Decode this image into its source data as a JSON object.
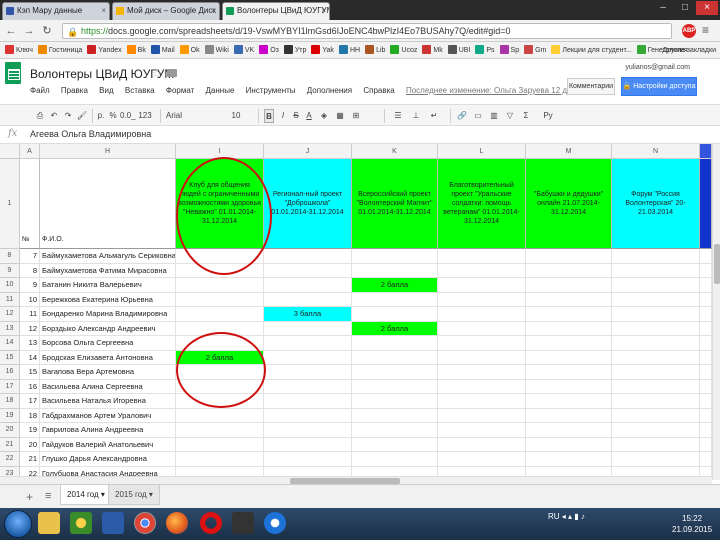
{
  "browser": {
    "tabs": [
      {
        "title": "Кэп Мару данные",
        "active": false
      },
      {
        "title": "Мой диск – Google Диск",
        "active": false
      },
      {
        "title": "Волонтеры ЦВиД ЮУГУМ",
        "active": true
      }
    ],
    "url_protocol": "https://",
    "url_rest": "docs.google.com/spreadsheets/d/19-VswMYBYI1lmGsd6IJoENC4bwPlzI4Eo7BUSAhy7Q/edit#gid=0",
    "adblock_label": "ABP",
    "bookmarks": [
      "Ключ",
      "Гостиница",
      "Yandex",
      "Bk",
      "Mail",
      "Ok",
      "Wiki",
      "VK",
      "Оз",
      "Утр",
      "Yak",
      "НН",
      "Lib",
      "Ucoz",
      "Mk",
      "UBI",
      "Ps",
      "Sp",
      "Gm",
      "Лекции для студент...",
      "Генетология"
    ],
    "other_bookmarks": "Другие закладки"
  },
  "docs": {
    "title": "Волонтеры ЦВиД ЮУГУМ",
    "user_email": "yulianos@gmail.com",
    "menu": [
      "Файл",
      "Правка",
      "Вид",
      "Вставка",
      "Формат",
      "Данные",
      "Инструменты",
      "Дополнения",
      "Справка"
    ],
    "last_edit": "Последнее изменение: Ольга Заруева 12 дней назад",
    "comments_label": "Комментарии",
    "share_label": "Настройки доступа"
  },
  "toolbar": {
    "zoom": "100%",
    "currency": "р.",
    "percent": "%",
    "decimals": "0.0_",
    "format": "123",
    "font": "Arial",
    "font_size": "10",
    "bold": "B",
    "italic": "I",
    "strike": "S",
    "textcolor": "A",
    "functions": "Σ",
    "input_tools": "Ру"
  },
  "formula_bar": {
    "icon": "fx",
    "value": "Агеева Ольга Владимировна"
  },
  "grid": {
    "column_headers": [
      "A",
      "H",
      "I",
      "J",
      "K",
      "L",
      "M",
      "N"
    ],
    "header_row": {
      "row_label": "1",
      "a": "№",
      "h": "Ф.И.О.",
      "i": "Клуб для общения людей с ограниченными возможностями здоровья \"Неважно\" 01.01.2014-31.12.2014",
      "j": "Регионал-ный проект \"Доброшкола\" 01.01.2014-31.12.2014",
      "k": "Всероссийский проект \"Волонтерский Магнит\" 01.01.2014-31.12.2014",
      "l": "Благотворительный проект \"Уральские солдатки: помощь ветеранам\" 01.01.2014-31.12.2014",
      "m": "\"Бабушки и дедушки\" онлайн 21.07.2014-31.12.2014",
      "n": "Форум \"Россия Волонтерская\" 20-21.03.2014"
    },
    "rows": [
      {
        "row": "8",
        "num": "7",
        "name": "Баймухаметова Альмагуль Сериковна",
        "mark": "",
        "mark_col": ""
      },
      {
        "row": "9",
        "num": "8",
        "name": "Баймухаметова Фатима Мирасовна",
        "mark": "",
        "mark_col": ""
      },
      {
        "row": "10",
        "num": "9",
        "name": "Батанин Никита Валерьевич",
        "mark": "2 балла",
        "mark_col": "k"
      },
      {
        "row": "11",
        "num": "10",
        "name": "Бережкова Екатерина Юрьевна",
        "mark": "",
        "mark_col": ""
      },
      {
        "row": "12",
        "num": "11",
        "name": "Бондаренко Марина Владимировна",
        "mark": "3 балла",
        "mark_col": "j"
      },
      {
        "row": "13",
        "num": "12",
        "name": "Борздыко Александр Андреевич",
        "mark": "2 балла",
        "mark_col": "k"
      },
      {
        "row": "14",
        "num": "13",
        "name": "Борсова Ольга Сергеевна",
        "mark": "",
        "mark_col": ""
      },
      {
        "row": "15",
        "num": "14",
        "name": "Бродская Елизавета Антоновна",
        "mark": "2 балла",
        "mark_col": "i"
      },
      {
        "row": "16",
        "num": "15",
        "name": "Вагапова Вера Артемовна",
        "mark": "",
        "mark_col": ""
      },
      {
        "row": "17",
        "num": "16",
        "name": "Васильева Алина Сергеевна",
        "mark": "",
        "mark_col": ""
      },
      {
        "row": "18",
        "num": "17",
        "name": "Васильева Наталья Игоревна",
        "mark": "",
        "mark_col": ""
      },
      {
        "row": "19",
        "num": "18",
        "name": "Габдрахманов Артем Уралович",
        "mark": "",
        "mark_col": ""
      },
      {
        "row": "20",
        "num": "19",
        "name": "Гаврилова Алина Андреевна",
        "mark": "",
        "mark_col": ""
      },
      {
        "row": "21",
        "num": "20",
        "name": "Гайдуков Валерий Анатольевич",
        "mark": "",
        "mark_col": ""
      },
      {
        "row": "22",
        "num": "21",
        "name": "Глушко Дарья Александровна",
        "mark": "",
        "mark_col": ""
      },
      {
        "row": "23",
        "num": "22",
        "name": "Голубцова Анастасия Андреевна",
        "mark": "",
        "mark_col": ""
      }
    ]
  },
  "sheets": {
    "add_icon": "+",
    "list_icon": "≡",
    "tabs": [
      "2014 год",
      "2015 год"
    ]
  },
  "taskbar": {
    "lang": "RU",
    "time": "15:22",
    "date": "21.09.2015"
  }
}
